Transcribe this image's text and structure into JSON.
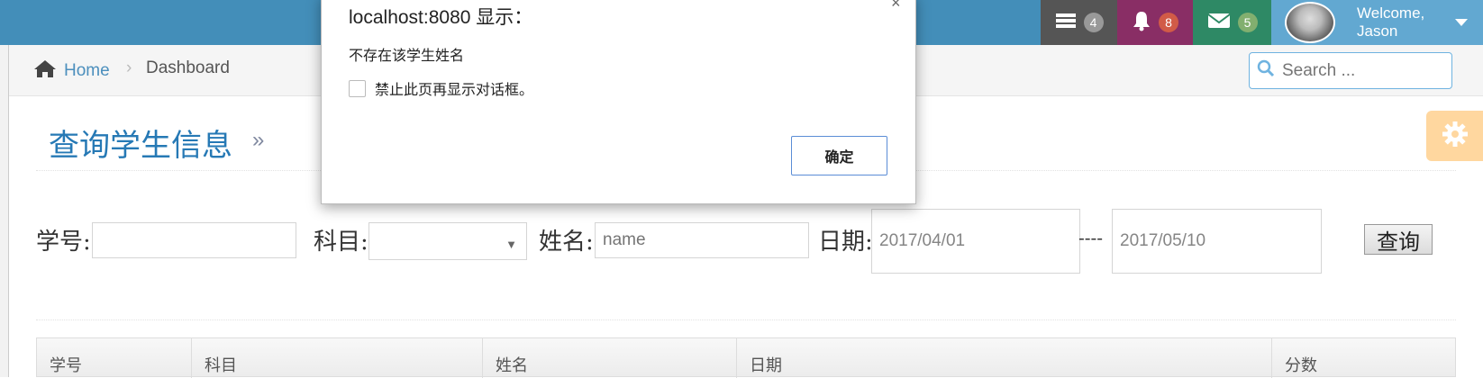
{
  "navbar": {
    "tasks_badge": "4",
    "notifications_badge": "8",
    "messages_badge": "5",
    "welcome_line1": "Welcome,",
    "welcome_line2": "Jason"
  },
  "breadcrumbs": {
    "home": "Home",
    "separator": "›",
    "current": "Dashboard"
  },
  "search": {
    "placeholder": "Search ..."
  },
  "page": {
    "title": "查询学生信息",
    "title_suffix": "»"
  },
  "form": {
    "student_id_label": "学号:",
    "student_id_value": "",
    "subject_label": "科目:",
    "subject_value": "",
    "name_label": "姓名:",
    "name_placeholder": "name",
    "date_label": "日期:",
    "date_from": "2017/04/01",
    "date_separator": "----",
    "date_to": "2017/05/10",
    "query_button": "查询"
  },
  "table": {
    "columns": [
      "学号",
      "科目",
      "姓名",
      "日期",
      "分数"
    ]
  },
  "dialog": {
    "title": "localhost:8080 显示：",
    "close": "×",
    "message": "不存在该学生姓名",
    "checkbox_label": "禁止此页再显示对话框。",
    "ok_button": "确定"
  },
  "colors": {
    "navbar": "#438eb9",
    "tasks_bg": "#555555",
    "notifications_bg": "#892e65",
    "messages_bg": "#2e8965",
    "user_bg": "#62a8d1",
    "title": "#2679b5",
    "settings_tab": "#ffb752"
  },
  "icons": {
    "tasks": "tasks-icon",
    "notifications": "bell-icon",
    "messages": "envelope-icon",
    "home": "home-icon",
    "search": "search-icon",
    "settings": "gear-icon",
    "user_menu": "caret-down-icon"
  }
}
